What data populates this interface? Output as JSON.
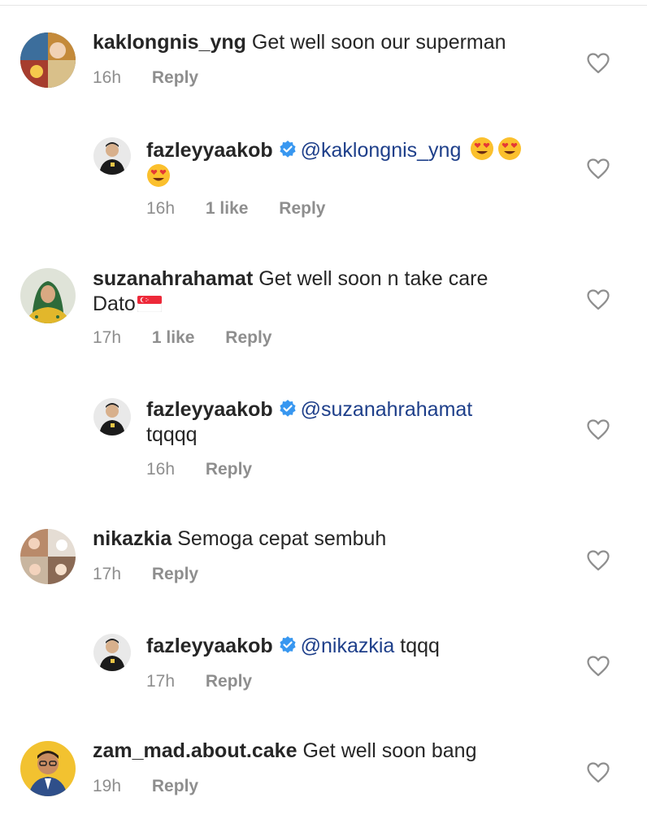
{
  "comments": [
    {
      "username": "kaklongnis_yng",
      "mention": "",
      "text": "Get well soon our superman",
      "time": "16h",
      "likes": "",
      "reply_label": "Reply"
    },
    {
      "username": "fazleyyaakob",
      "mention": "@kaklongnis_yng",
      "text": "",
      "time": "16h",
      "likes": "1 like",
      "reply_label": "Reply"
    },
    {
      "username": "suzanahrahamat",
      "mention": "",
      "text": "Get well soon n take care",
      "text2": "Dato",
      "time": "17h",
      "likes": "1 like",
      "reply_label": "Reply"
    },
    {
      "username": "fazleyyaakob",
      "mention": "@suzanahrahamat",
      "text": "tqqqq",
      "time": "16h",
      "likes": "",
      "reply_label": "Reply"
    },
    {
      "username": "nikazkia",
      "mention": "",
      "text": "Semoga cepat sembuh",
      "time": "17h",
      "likes": "",
      "reply_label": "Reply"
    },
    {
      "username": "fazleyyaakob",
      "mention": "@nikazkia",
      "text": "tqqq",
      "time": "17h",
      "likes": "",
      "reply_label": "Reply"
    },
    {
      "username": "zam_mad.about.cake",
      "mention": "",
      "text": "Get well soon bang",
      "time": "19h",
      "likes": "",
      "reply_label": "Reply"
    }
  ],
  "icons": {
    "verified": "verified-badge-icon",
    "like": "heart-outline-icon",
    "emoji": "heart-eyes-emoji",
    "flag": "singapore-flag-emoji"
  },
  "colors": {
    "verified_blue": "#3897f0",
    "mention_blue": "#1e3f8a",
    "meta_gray": "#8e8e8e",
    "text": "#262626"
  }
}
